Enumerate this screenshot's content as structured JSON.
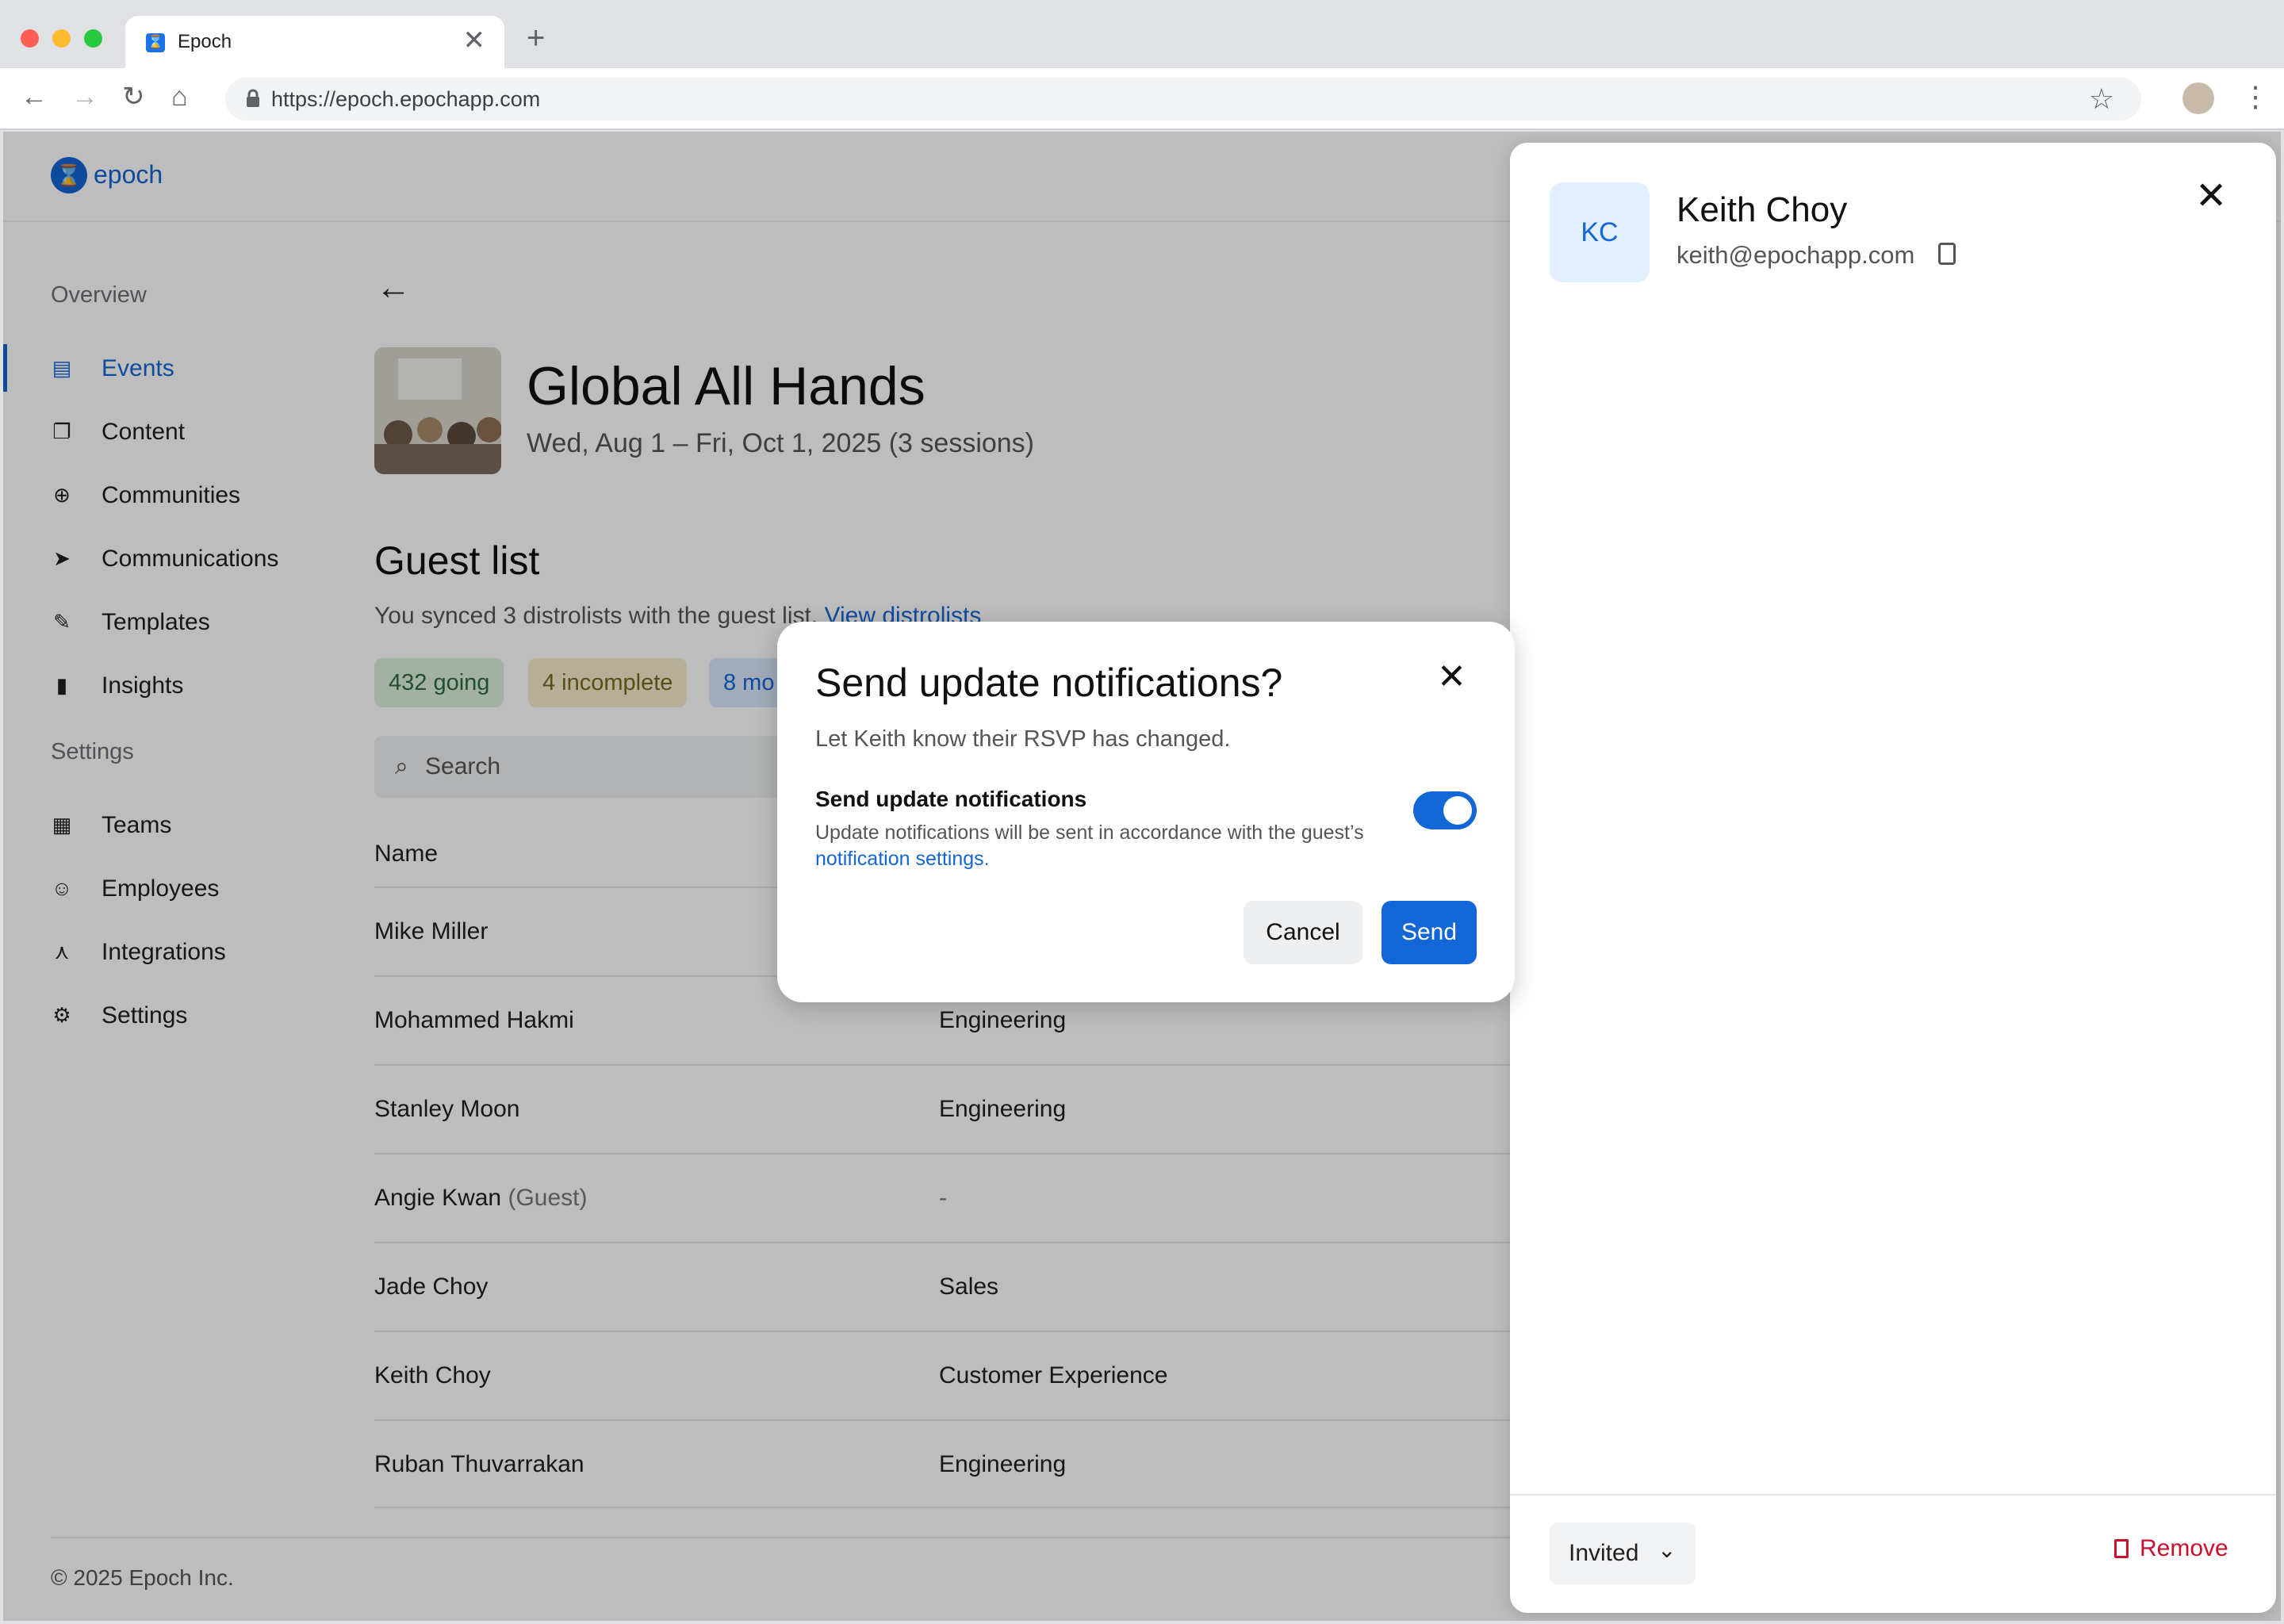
{
  "browser": {
    "tab_title": "Epoch",
    "url": "https://epoch.epochapp.com",
    "new_tab": "+",
    "close_tab": "✕"
  },
  "app": {
    "logo_text": "epoch",
    "logo_glyph": "⌛",
    "accent": "#1366d6"
  },
  "sidebar": {
    "overview_label": "Overview",
    "overview_items": [
      {
        "label": "Events",
        "icon": "calendar-icon"
      },
      {
        "label": "Content",
        "icon": "book-icon"
      },
      {
        "label": "Communities",
        "icon": "globe-icon"
      },
      {
        "label": "Communications",
        "icon": "send-icon"
      },
      {
        "label": "Templates",
        "icon": "wrench-icon"
      },
      {
        "label": "Insights",
        "icon": "bar-chart-icon"
      }
    ],
    "settings_label": "Settings",
    "settings_items": [
      {
        "label": "Teams",
        "icon": "building-icon"
      },
      {
        "label": "Employees",
        "icon": "people-icon"
      },
      {
        "label": "Integrations",
        "icon": "integrations-icon"
      },
      {
        "label": "Settings",
        "icon": "gear-icon"
      }
    ]
  },
  "event": {
    "title": "Global All Hands",
    "date": "Wed, Aug 1 – Fri, Oct 1, 2025 (3 sessions)"
  },
  "guest_list": {
    "title": "Guest list",
    "subtitle": "You synced 3 distrolists with the guest list.",
    "subtitle_link": "View distrolists",
    "pills": [
      {
        "label": "432 going",
        "color": "#2e6b3a",
        "bg": "#dcefdf"
      },
      {
        "label": "4 incomplete",
        "color": "#7a6a1e",
        "bg": "#f5edcc"
      },
      {
        "label": "8 mo",
        "color": "#1366d6",
        "bg": "#dbe8fb"
      }
    ],
    "search_placeholder": "Search",
    "column_name": "Name",
    "rows": [
      {
        "name": "Mike Miller",
        "tag": "",
        "dept": ""
      },
      {
        "name": "Mohammed Hakmi",
        "tag": "",
        "dept": "Engineering"
      },
      {
        "name": "Stanley Moon",
        "tag": "",
        "dept": "Engineering"
      },
      {
        "name": "Angie Kwan",
        "tag": "(Guest)",
        "dept": "-"
      },
      {
        "name": "Jade Choy",
        "tag": "",
        "dept": "Sales"
      },
      {
        "name": "Keith Choy",
        "tag": "",
        "dept": "Customer Experience"
      },
      {
        "name": "Ruban Thuvarrakan",
        "tag": "",
        "dept": "Engineering"
      }
    ]
  },
  "footer": {
    "copyright": "© 2025 Epoch Inc."
  },
  "panel": {
    "initials": "KC",
    "name": "Keith Choy",
    "email": "keith@epochapp.com",
    "status": "Invited",
    "remove_label": "Remove"
  },
  "dialog": {
    "title": "Send update notifications?",
    "description": "Let Keith know their RSVP has changed.",
    "toggle_label": "Send update notifications",
    "help_text": "Update notifications will be sent in accordance with the guest’s",
    "help_link": "notification settings.",
    "toggle_on": true,
    "cancel_label": "Cancel",
    "send_label": "Send"
  }
}
